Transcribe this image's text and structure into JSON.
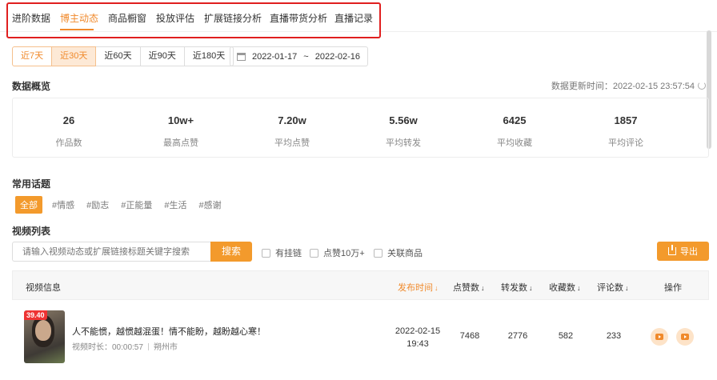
{
  "nav": {
    "tabs": [
      "进阶数据",
      "博主动态",
      "商品橱窗",
      "投放评估",
      "扩展链接分析",
      "直播带货分析",
      "直播记录"
    ],
    "active": "博主动态"
  },
  "range": {
    "chips": [
      "近7天",
      "近30天",
      "近60天",
      "近90天",
      "近180天"
    ],
    "active": "近30天",
    "start": "2022-01-17",
    "sep": "~",
    "end": "2022-02-16"
  },
  "overview": {
    "title": "数据概览",
    "updated": "数据更新时间：2022-02-15 23:57:54",
    "stats": [
      {
        "value": "26",
        "label": "作品数"
      },
      {
        "value": "10w+",
        "label": "最高点赞"
      },
      {
        "value": "7.20w",
        "label": "平均点赞"
      },
      {
        "value": "5.56w",
        "label": "平均转发"
      },
      {
        "value": "6425",
        "label": "平均收藏"
      },
      {
        "value": "1857",
        "label": "平均评论"
      }
    ]
  },
  "topics": {
    "title": "常用话题",
    "all": "全部",
    "items": [
      "#情感",
      "#励志",
      "#正能量",
      "#生活",
      "#感谢"
    ]
  },
  "videos": {
    "title": "视频列表",
    "search_placeholder": "请输入视频动态或扩展链接标题关键字搜索",
    "search_button": "搜索",
    "filters": [
      "有挂链",
      "点赞10万+",
      "关联商品"
    ],
    "export": "导出",
    "columns": {
      "info": "视频信息",
      "time": "发布时间",
      "likes": "点赞数",
      "shares": "转发数",
      "favorites": "收藏数",
      "comments": "评论数",
      "actions": "操作"
    },
    "sort_glyph": "↓",
    "rows": [
      {
        "badge": "39.40",
        "title": "人不能惯，越惯越混蛋！情不能盼，越盼越心寒！",
        "duration": "视频时长：00:00:57",
        "location": "朔州市",
        "date": "2022-02-15",
        "time": "19:43",
        "likes": "7468",
        "shares": "2776",
        "favorites": "582",
        "comments": "233"
      }
    ]
  },
  "colors": {
    "accent": "#f08a2c",
    "button": "#f39a2c",
    "highlight_box": "#e01f1f"
  },
  "icons": [
    "calendar-icon",
    "refresh-icon",
    "upload-icon",
    "play-icon",
    "video-icon"
  ]
}
